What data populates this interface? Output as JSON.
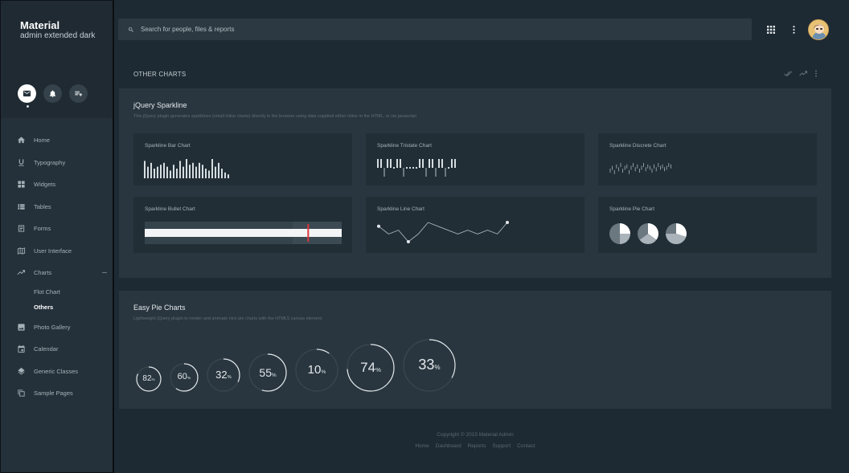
{
  "brand": {
    "title": "Material",
    "subtitle": "admin extended dark"
  },
  "profile_actions": [
    "mail-icon",
    "bell-icon",
    "playlist-add-icon"
  ],
  "nav": {
    "items": [
      {
        "label": "Home",
        "icon": "home-icon"
      },
      {
        "label": "Typography",
        "icon": "format-underline-icon"
      },
      {
        "label": "Widgets",
        "icon": "widgets-icon"
      },
      {
        "label": "Tables",
        "icon": "view-list-icon"
      },
      {
        "label": "Forms",
        "icon": "forms-icon"
      },
      {
        "label": "User Interface",
        "icon": "map-icon"
      },
      {
        "label": "Charts",
        "icon": "trending-up-icon"
      },
      {
        "label": "Photo Gallery",
        "icon": "image-icon"
      },
      {
        "label": "Calendar",
        "icon": "calendar-icon"
      },
      {
        "label": "Generic Classes",
        "icon": "layers-icon"
      },
      {
        "label": "Sample Pages",
        "icon": "copy-icon"
      }
    ],
    "charts_sub": [
      {
        "label": "Flot Chart",
        "active": false
      },
      {
        "label": "Others",
        "active": true
      }
    ]
  },
  "search": {
    "placeholder": "Search for people, files & reports"
  },
  "header_icons": [
    "apps-grid-icon",
    "more-vert-icon",
    "avatar"
  ],
  "block": {
    "title": "OTHER CHARTS",
    "actions": [
      "done-all-icon",
      "trending-up-icon",
      "more-vert-icon"
    ]
  },
  "sparkline": {
    "title": "jQuery Sparkline",
    "subtitle": "This jQuery plugin generates sparklines (small inline charts) directly in the browser using data supplied either inline in the HTML, or via javascript",
    "cards": [
      {
        "title": "Sparkline Bar Chart"
      },
      {
        "title": "Sparkline Tristate Chart"
      },
      {
        "title": "Sparkline Discrete Chart"
      },
      {
        "title": "Sparkline Bullet Chart"
      },
      {
        "title": "Sparkline Line Chart"
      },
      {
        "title": "Sparkline Pie Chart"
      }
    ],
    "bar_values": [
      9,
      6,
      8,
      5,
      6,
      7,
      8,
      6,
      4,
      7,
      5,
      9,
      6,
      10,
      7,
      8,
      6,
      8,
      7,
      5,
      4,
      10,
      6,
      8,
      5,
      3,
      2
    ],
    "tristate_values": [
      1,
      1,
      -1,
      1,
      1,
      0,
      1,
      1,
      -1,
      0,
      0,
      0,
      0,
      1,
      1,
      -1,
      1,
      1,
      -1,
      1,
      1,
      -1,
      0,
      1,
      1
    ],
    "discrete_values": [
      4,
      6,
      3,
      7,
      5,
      8,
      4,
      6,
      7,
      3,
      6,
      8,
      5,
      7,
      4,
      6,
      8,
      5,
      7,
      6,
      4,
      7,
      5,
      8,
      6,
      7,
      5,
      6,
      8,
      7
    ],
    "line_values": [
      5,
      3,
      4,
      1,
      3,
      6,
      5,
      4,
      3,
      4,
      3,
      4,
      3,
      6
    ],
    "bullet": {
      "target": 0.83,
      "performance": 1.0,
      "ranges": [
        0.75,
        1.0
      ]
    },
    "pies": [
      [
        25,
        25,
        50
      ],
      [
        35,
        30,
        35
      ],
      [
        30,
        45,
        25
      ]
    ]
  },
  "easy_pie": {
    "title": "Easy Pie Charts",
    "subtitle": "Lightweight jQuery plugin to render and animate nice pie charts with the HTML5 canvas element",
    "charts": [
      {
        "value": "82",
        "unit": "%"
      },
      {
        "value": "60",
        "unit": "%"
      },
      {
        "value": "32",
        "unit": "%"
      },
      {
        "value": "55",
        "unit": "%"
      },
      {
        "value": "10",
        "unit": "%"
      },
      {
        "value": "74",
        "unit": "%"
      },
      {
        "value": "33",
        "unit": "%"
      }
    ]
  },
  "footer": {
    "copyright": "Copyright © 2015 Material Admin",
    "links": [
      "Home",
      "Dashboard",
      "Reports",
      "Support",
      "Contact"
    ]
  }
}
